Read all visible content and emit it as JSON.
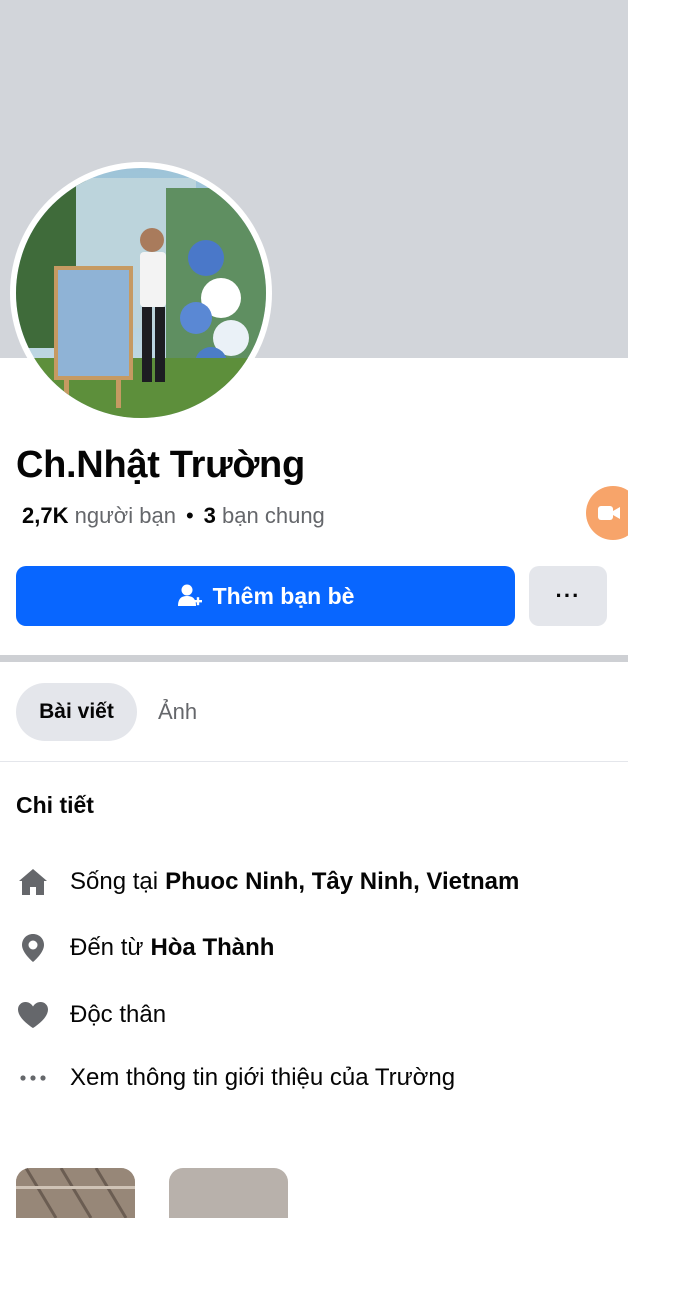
{
  "profile": {
    "name": "Ch.Nhật Trường",
    "friends_count": "2,7K",
    "friends_label": "người bạn",
    "separator": "•",
    "mutual_count": "3",
    "mutual_label": "bạn chung"
  },
  "actions": {
    "add_friend_label": "Thêm bạn bè",
    "more_label": "···"
  },
  "tabs": [
    {
      "label": "Bài viết",
      "active": true
    },
    {
      "label": "Ảnh",
      "active": false
    }
  ],
  "details": {
    "title": "Chi tiết",
    "items": [
      {
        "icon": "home-icon",
        "prefix": "Sống tại",
        "value": "Phuoc Ninh, Tây Ninh, Vietnam"
      },
      {
        "icon": "location-pin-icon",
        "prefix": "Đến từ",
        "value": "Hòa Thành"
      },
      {
        "icon": "heart-icon",
        "prefix": "Độc thân",
        "value": ""
      },
      {
        "icon": "more-dots-icon",
        "prefix": "Xem thông tin giới thiệu của Trường",
        "value": ""
      }
    ]
  },
  "colors": {
    "primary": "#0866ff",
    "cover": "#d2d5da",
    "secondary_button": "#e4e6eb",
    "video_badge": "#f7a46a"
  }
}
